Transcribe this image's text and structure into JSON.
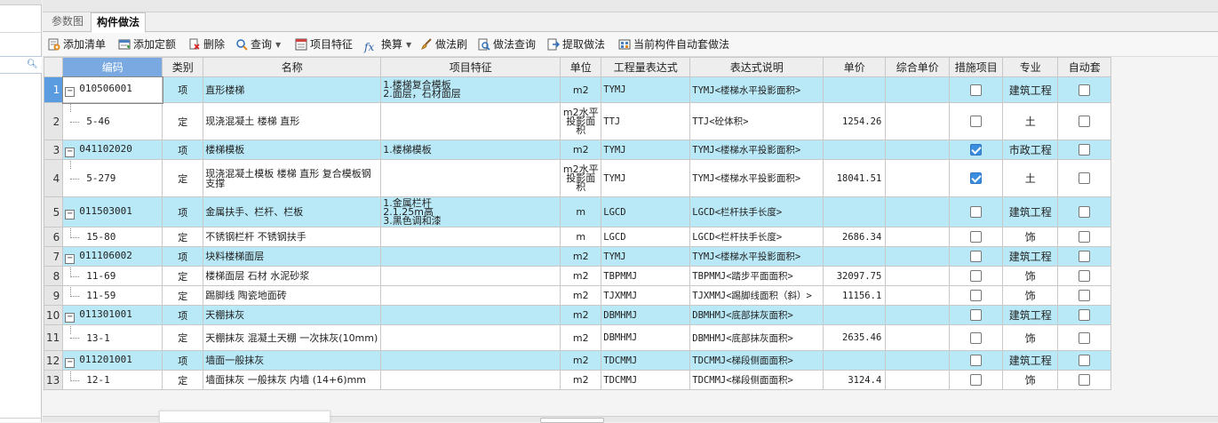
{
  "tabs": [
    {
      "label": "参数图",
      "active": false
    },
    {
      "label": "构件做法",
      "active": true
    }
  ],
  "toolbar": [
    {
      "label": "添加清单",
      "icon": "add-list-icon",
      "caret": false
    },
    {
      "label": "添加定额",
      "icon": "add-quota-icon",
      "caret": false
    },
    {
      "label": "删除",
      "icon": "delete-icon",
      "caret": false
    },
    {
      "label": "查询",
      "icon": "search-icon",
      "caret": true
    },
    {
      "label": "项目特征",
      "icon": "feature-icon",
      "caret": false
    },
    {
      "label": "换算",
      "icon": "fx-icon",
      "caret": true
    },
    {
      "label": "做法刷",
      "icon": "brush-icon",
      "caret": false
    },
    {
      "label": "做法查询",
      "icon": "method-search-icon",
      "caret": false
    },
    {
      "label": "提取做法",
      "icon": "extract-icon",
      "caret": false
    },
    {
      "label": "当前构件自动套做法",
      "icon": "auto-apply-icon",
      "caret": false
    }
  ],
  "columns": [
    "编码",
    "类别",
    "名称",
    "项目特征",
    "单位",
    "工程量表达式",
    "表达式说明",
    "单价",
    "综合单价",
    "措施项目",
    "专业",
    "自动套"
  ],
  "rows": [
    {
      "num": "1",
      "code": "010506001",
      "type": "项",
      "name": "直形楼梯",
      "spec": "1.楼梯复合模板\n2.面层，石材面层",
      "unit": "m2",
      "expr": "TYMJ",
      "desc": "TYMJ<楼梯水平投影面积>",
      "price": "",
      "cprice": "",
      "measure": false,
      "major": "建筑工程",
      "auto": false,
      "parent": true
    },
    {
      "num": "2",
      "code": "5-46",
      "type": "定",
      "name": "现浇混凝土 楼梯 直形",
      "spec": "",
      "unit": "m2水平投影面积",
      "expr": "TTJ",
      "desc": "TTJ<砼体积>",
      "price": "1254.26",
      "cprice": "",
      "measure": false,
      "major": "土",
      "auto": false,
      "parent": false
    },
    {
      "num": "3",
      "code": "041102020",
      "type": "项",
      "name": "楼梯模板",
      "spec": "1.楼梯模板",
      "unit": "m2",
      "expr": "TYMJ",
      "desc": "TYMJ<楼梯水平投影面积>",
      "price": "",
      "cprice": "",
      "measure": true,
      "major": "市政工程",
      "auto": false,
      "parent": true
    },
    {
      "num": "4",
      "code": "5-279",
      "type": "定",
      "name": "现浇混凝土模板 楼梯 直形 复合模板钢支撑",
      "spec": "",
      "unit": "m2水平投影面积",
      "expr": "TYMJ",
      "desc": "TYMJ<楼梯水平投影面积>",
      "price": "18041.51",
      "cprice": "",
      "measure": true,
      "major": "土",
      "auto": false,
      "parent": false
    },
    {
      "num": "5",
      "code": "011503001",
      "type": "项",
      "name": "金属扶手、栏杆、栏板",
      "spec": "1.金属栏杆\n2.1.25m高\n3.黑色调和漆",
      "unit": "m",
      "expr": "LGCD",
      "desc": "LGCD<栏杆扶手长度>",
      "price": "",
      "cprice": "",
      "measure": false,
      "major": "建筑工程",
      "auto": false,
      "parent": true
    },
    {
      "num": "6",
      "code": "15-80",
      "type": "定",
      "name": "不锈钢栏杆 不锈钢扶手",
      "spec": "",
      "unit": "m",
      "expr": "LGCD",
      "desc": "LGCD<栏杆扶手长度>",
      "price": "2686.34",
      "cprice": "",
      "measure": false,
      "major": "饰",
      "auto": false,
      "parent": false
    },
    {
      "num": "7",
      "code": "011106002",
      "type": "项",
      "name": "块料楼梯面层",
      "spec": "",
      "unit": "m2",
      "expr": "TYMJ",
      "desc": "TYMJ<楼梯水平投影面积>",
      "price": "",
      "cprice": "",
      "measure": false,
      "major": "建筑工程",
      "auto": false,
      "parent": true
    },
    {
      "num": "8",
      "code": "11-69",
      "type": "定",
      "name": "楼梯面层 石材 水泥砂浆",
      "spec": "",
      "unit": "m2",
      "expr": "TBPMMJ",
      "desc": "TBPMMJ<踏步平面面积>",
      "price": "32097.75",
      "cprice": "",
      "measure": false,
      "major": "饰",
      "auto": false,
      "parent": false
    },
    {
      "num": "9",
      "code": "11-59",
      "type": "定",
      "name": "踢脚线 陶瓷地面砖",
      "spec": "",
      "unit": "m2",
      "expr": "TJXMMJ",
      "desc": "TJXMMJ<踢脚线面积（斜）>",
      "price": "11156.1",
      "cprice": "",
      "measure": false,
      "major": "饰",
      "auto": false,
      "parent": false
    },
    {
      "num": "10",
      "code": "011301001",
      "type": "项",
      "name": "天棚抹灰",
      "spec": "",
      "unit": "m2",
      "expr": "DBMHMJ",
      "desc": "DBMHMJ<底部抹灰面积>",
      "price": "",
      "cprice": "",
      "measure": false,
      "major": "建筑工程",
      "auto": false,
      "parent": true
    },
    {
      "num": "11",
      "code": "13-1",
      "type": "定",
      "name": "天棚抹灰 混凝土天棚 一次抹灰(10mm)",
      "spec": "",
      "unit": "m2",
      "expr": "DBMHMJ",
      "desc": "DBMHMJ<底部抹灰面积>",
      "price": "2635.46",
      "cprice": "",
      "measure": false,
      "major": "饰",
      "auto": false,
      "parent": false
    },
    {
      "num": "12",
      "code": "011201001",
      "type": "项",
      "name": "墙面一般抹灰",
      "spec": "",
      "unit": "m2",
      "expr": "TDCMMJ",
      "desc": "TDCMMJ<梯段侧面面积>",
      "price": "",
      "cprice": "",
      "measure": false,
      "major": "建筑工程",
      "auto": false,
      "parent": true
    },
    {
      "num": "13",
      "code": "12-1",
      "type": "定",
      "name": "墙面抹灰 一般抹灰 内墙 (14+6)mm",
      "spec": "",
      "unit": "m2",
      "expr": "TDCMMJ",
      "desc": "TDCMMJ<梯段侧面面积>",
      "price": "3124.4",
      "cprice": "",
      "measure": false,
      "major": "饰",
      "auto": false,
      "parent": false
    }
  ]
}
